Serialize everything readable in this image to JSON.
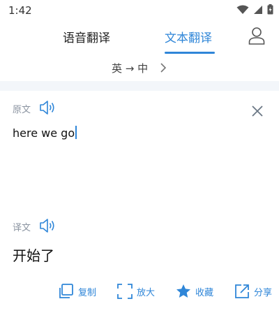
{
  "status": {
    "time": "1:42"
  },
  "tabs": {
    "voice": "语音翻译",
    "text": "文本翻译"
  },
  "language": {
    "pair": "英 → 中"
  },
  "source": {
    "label": "原文",
    "text": "here we go"
  },
  "target": {
    "label": "译文",
    "text": "开始了"
  },
  "actions": {
    "copy": "复制",
    "zoom": "放大",
    "favorite": "收藏",
    "share": "分享"
  },
  "colors": {
    "accent": "#2f86d8",
    "label": "#8a93a0",
    "band": "#f3f6fa"
  },
  "icons": [
    "wifi-icon",
    "signal-icon",
    "battery-icon",
    "user-icon",
    "chevron-right-icon",
    "speaker-icon",
    "close-icon",
    "copy-icon",
    "zoom-icon",
    "star-icon",
    "share-icon"
  ]
}
